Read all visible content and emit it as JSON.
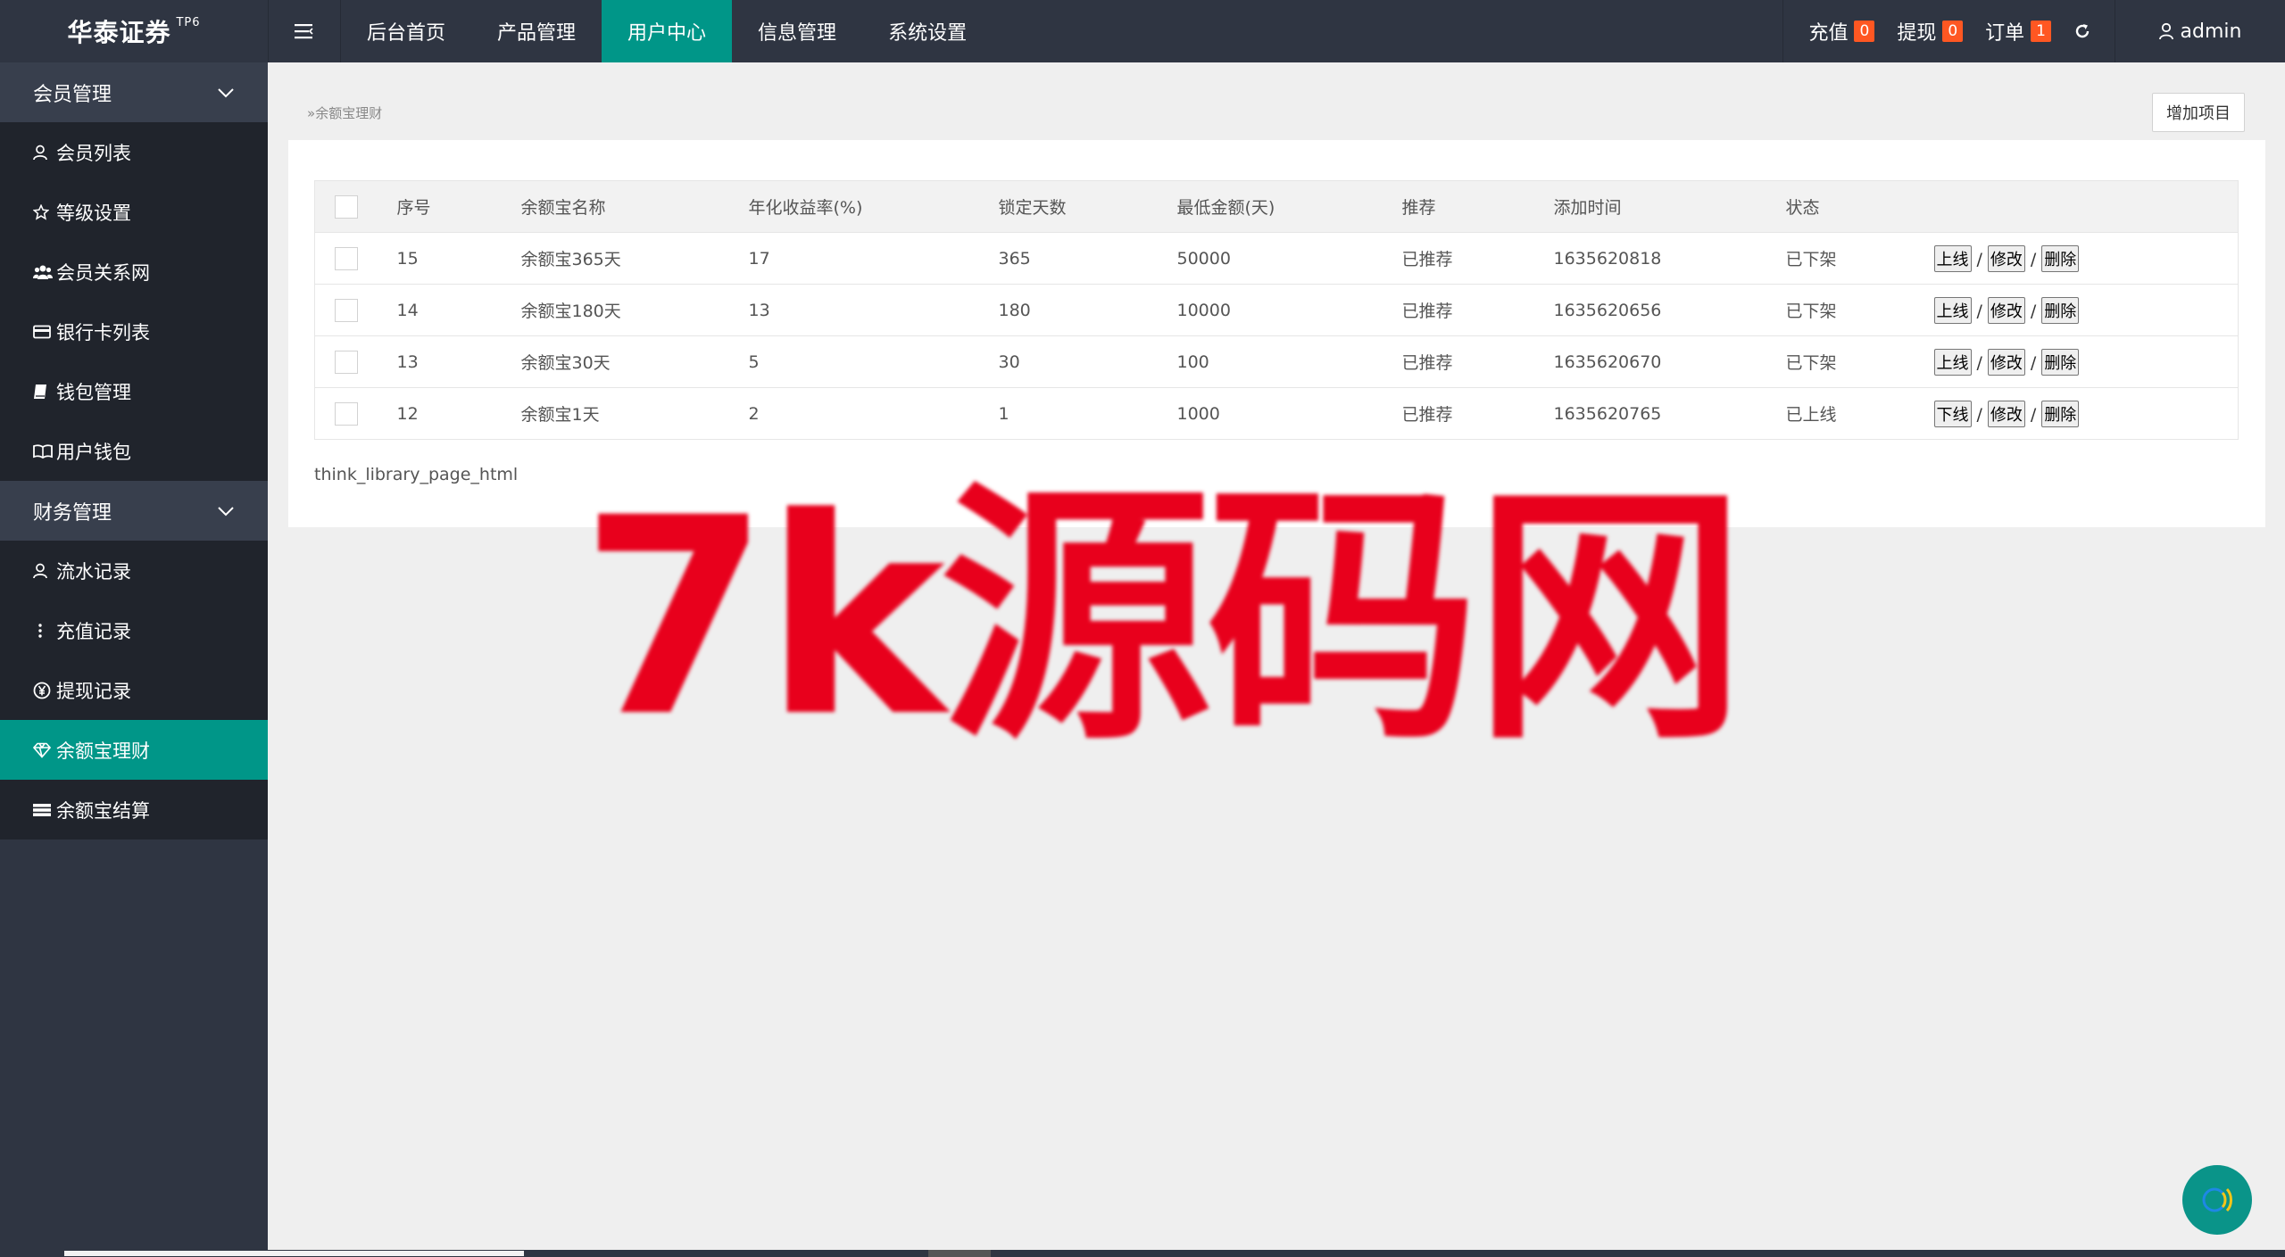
{
  "header": {
    "logo": "华泰证券",
    "logo_sup": "TP6",
    "nav": [
      "后台首页",
      "产品管理",
      "用户中心",
      "信息管理",
      "系统设置"
    ],
    "active_nav": "用户中心",
    "counters": [
      {
        "label": "充值",
        "count": "0"
      },
      {
        "label": "提现",
        "count": "0"
      },
      {
        "label": "订单",
        "count": "1"
      }
    ],
    "user": "admin"
  },
  "sidebar": {
    "groups": [
      {
        "label": "会员管理",
        "items": [
          {
            "label": "会员列表",
            "icon": "user-icon"
          },
          {
            "label": "等级设置",
            "icon": "star-icon"
          },
          {
            "label": "会员关系网",
            "icon": "users-icon"
          },
          {
            "label": "银行卡列表",
            "icon": "credit-card-icon"
          },
          {
            "label": "钱包管理",
            "icon": "book-icon"
          },
          {
            "label": "用户钱包",
            "icon": "open-book-icon"
          }
        ]
      },
      {
        "label": "财务管理",
        "items": [
          {
            "label": "流水记录",
            "icon": "user-icon"
          },
          {
            "label": "充值记录",
            "icon": "more-vertical-icon"
          },
          {
            "label": "提现记录",
            "icon": "yen-circle-icon"
          },
          {
            "label": "余额宝理财",
            "icon": "diamond-icon",
            "active": true
          },
          {
            "label": "余额宝结算",
            "icon": "list-icon"
          }
        ]
      }
    ]
  },
  "breadcrumb": "余额宝理财",
  "add_button": "增加项目",
  "table": {
    "headers": [
      "序号",
      "余额宝名称",
      "年化收益率(%)",
      "锁定天数",
      "最低金额(天)",
      "推荐",
      "添加时间",
      "状态"
    ],
    "rows": [
      {
        "id": "15",
        "name": "余额宝365天",
        "rate": "17",
        "days": "365",
        "min": "50000",
        "rec": "已推荐",
        "time": "1635620818",
        "status": "已下架",
        "toggle": "上线",
        "edit": "修改",
        "del": "删除"
      },
      {
        "id": "14",
        "name": "余额宝180天",
        "rate": "13",
        "days": "180",
        "min": "10000",
        "rec": "已推荐",
        "time": "1635620656",
        "status": "已下架",
        "toggle": "上线",
        "edit": "修改",
        "del": "删除"
      },
      {
        "id": "13",
        "name": "余额宝30天",
        "rate": "5",
        "days": "30",
        "min": "100",
        "rec": "已推荐",
        "time": "1635620670",
        "status": "已下架",
        "toggle": "上线",
        "edit": "修改",
        "del": "删除"
      },
      {
        "id": "12",
        "name": "余额宝1天",
        "rate": "2",
        "days": "1",
        "min": "1000",
        "rec": "已推荐",
        "time": "1635620765",
        "status": "已上线",
        "toggle": "下线",
        "edit": "修改",
        "del": "删除"
      }
    ]
  },
  "pager_text": "think_library_page_html",
  "watermark": "7k源码网",
  "colors": {
    "accent": "#009688",
    "badge": "#ff5722",
    "header_bg": "#2f3542",
    "watermark": "#e8001c"
  }
}
